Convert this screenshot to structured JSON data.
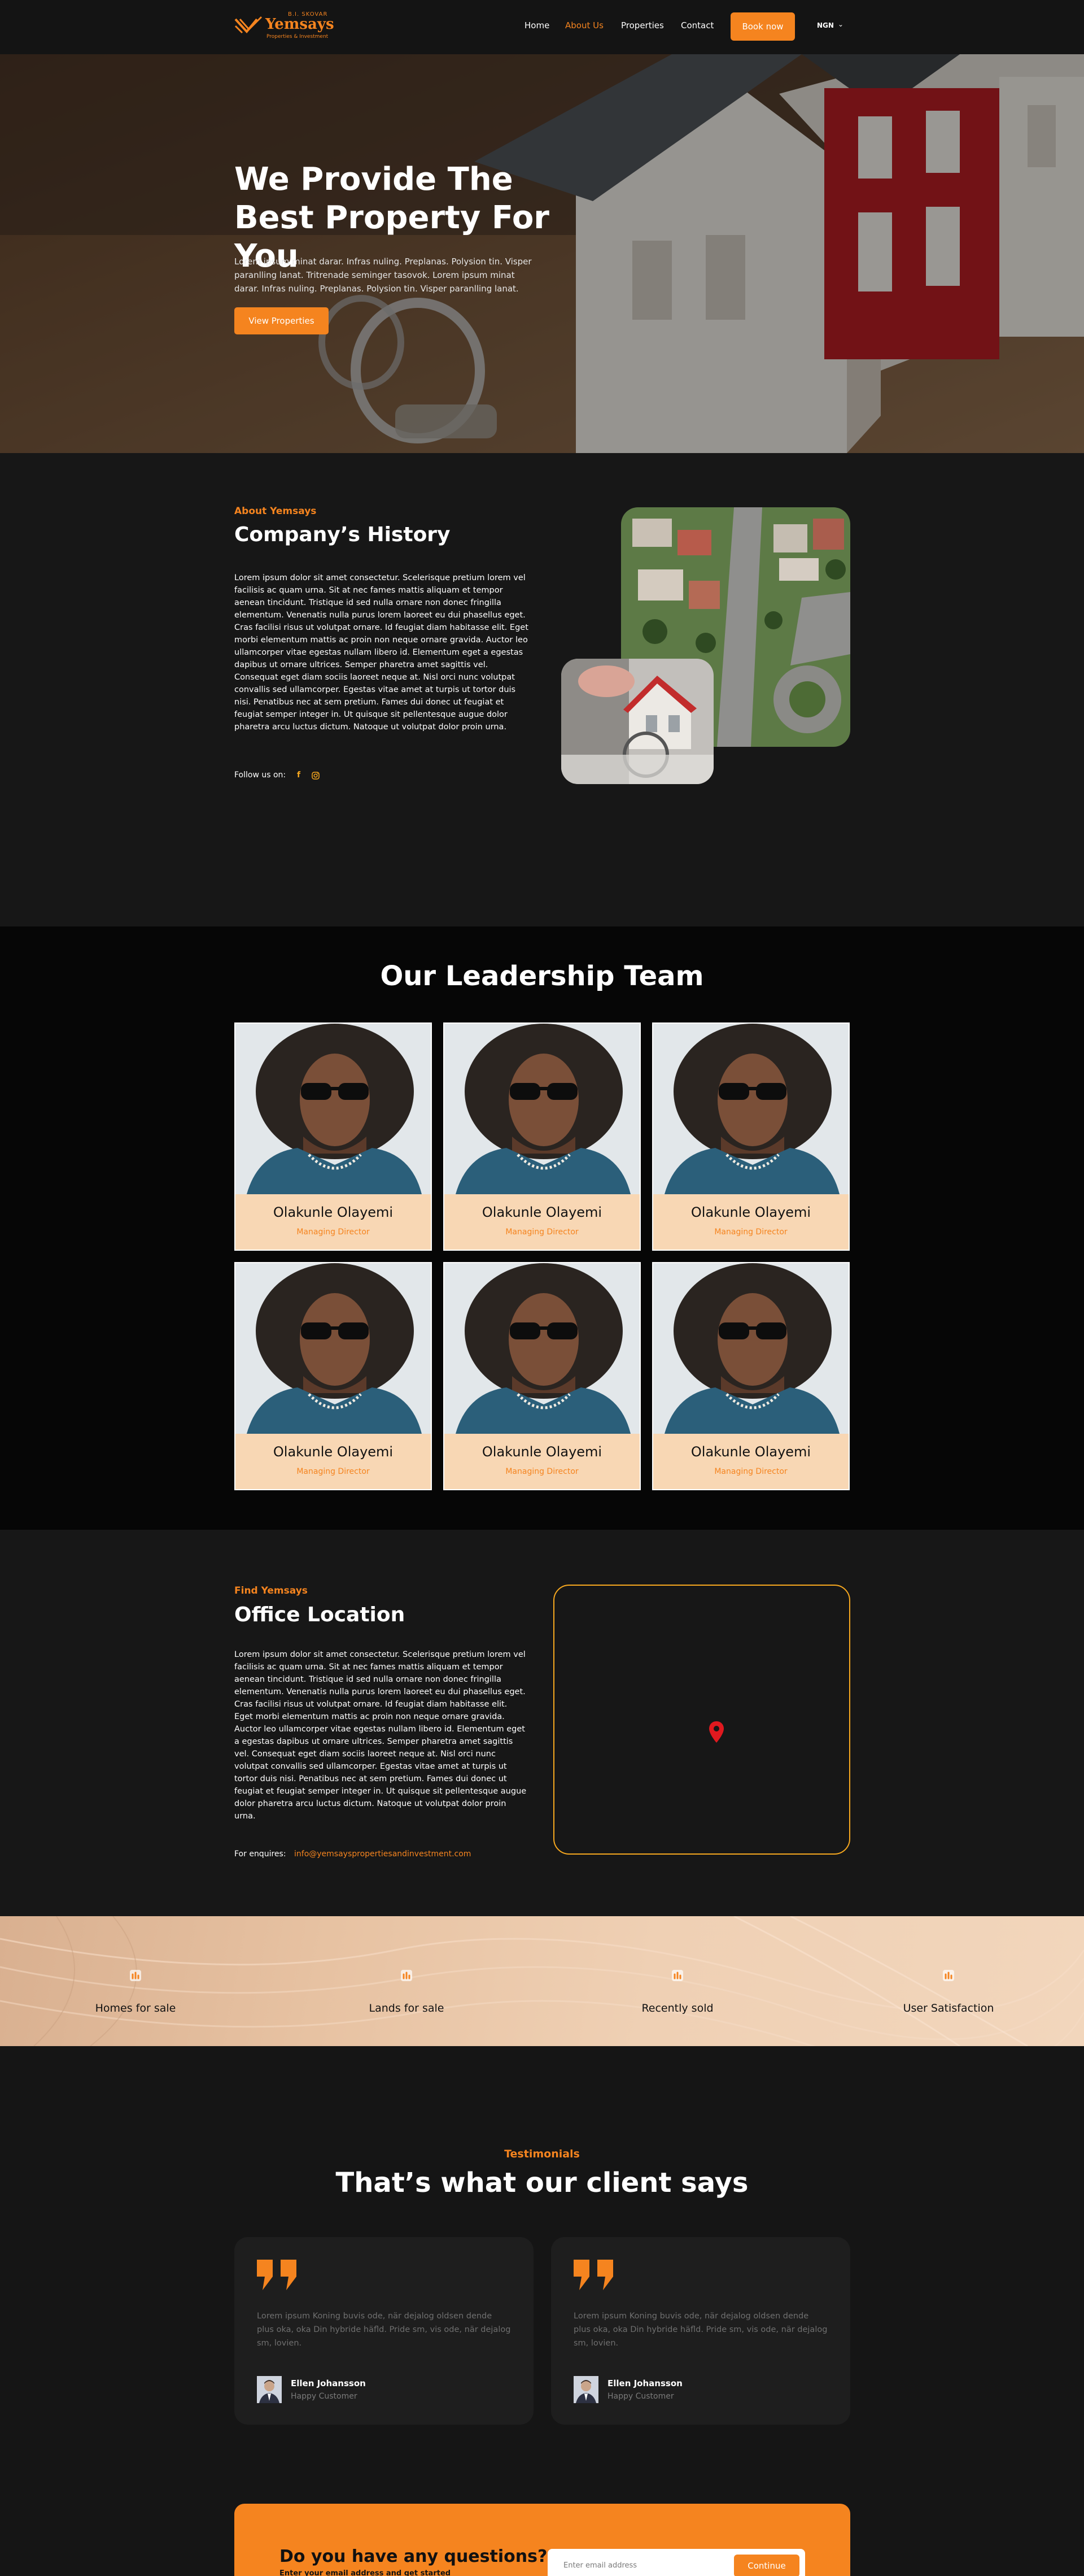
{
  "brand": {
    "small": "B.I. SKOVAR",
    "name": "Yemsays",
    "tagline": "Properties & Investment",
    "accent": "#f5841f"
  },
  "nav": {
    "items": [
      {
        "label": "Home",
        "active": false
      },
      {
        "label": "About Us",
        "active": true
      },
      {
        "label": "Properties",
        "active": false
      },
      {
        "label": "Contact",
        "active": false
      }
    ],
    "book_label": "Book now",
    "language": "NGN",
    "language_icon": "chevron-down-icon"
  },
  "hero": {
    "title": "We Provide The Best Property For You",
    "text": "Lorem ipsum minat darar. Infras nuling. Preplanas. Polysion tin. Visper paranlling lanat. Tritrenade seminger tasovok. Lorem ipsum minat darar. Infras nuling. Preplanas. Polysion tin. Visper paranlling lanat.",
    "button": "View Properties"
  },
  "about": {
    "eyebrow": "About Yemsays",
    "title": "Company’s History",
    "text": "Lorem ipsum dolor sit amet consectetur. Scelerisque pretium lorem vel facilisis ac quam urna. Sit at nec fames mattis aliquam et tempor aenean tincidunt. Tristique id sed nulla ornare non donec fringilla elementum. Venenatis nulla purus lorem laoreet eu dui phasellus eget. Cras facilisi risus ut volutpat ornare. Id feugiat diam habitasse elit. Eget morbi elementum mattis ac proin non neque ornare gravida. Auctor leo ullamcorper vitae egestas nullam libero id. Elementum eget a egestas dapibus ut ornare ultrices. Semper pharetra amet sagittis vel. Consequat eget diam sociis laoreet neque at. Nisl orci nunc volutpat convallis sed ullamcorper. Egestas vitae amet at turpis ut tortor duis nisi. Penatibus nec at sem pretium. Fames dui donec ut feugiat et feugiat semper integer in. Ut quisque sit pellentesque augue dolor pharetra arcu luctus dictum. Natoque ut volutpat dolor proin urna.",
    "follow_label": "Follow us on:",
    "social_icons": [
      "facebook-icon",
      "instagram-icon"
    ]
  },
  "team": {
    "title": "Our Leadership Team",
    "members": [
      {
        "name": "Olakunle Olayemi",
        "role": "Managing Director"
      },
      {
        "name": "Olakunle Olayemi",
        "role": "Managing Director"
      },
      {
        "name": "Olakunle Olayemi",
        "role": "Managing Director"
      },
      {
        "name": "Olakunle Olayemi",
        "role": "Managing Director"
      },
      {
        "name": "Olakunle Olayemi",
        "role": "Managing Director"
      },
      {
        "name": "Olakunle Olayemi",
        "role": "Managing Director"
      }
    ]
  },
  "office": {
    "eyebrow": "Find Yemsays",
    "title": "Office Location",
    "text": "Lorem ipsum dolor sit amet consectetur. Scelerisque pretium lorem vel facilisis ac quam urna. Sit at nec fames mattis aliquam et tempor aenean tincidunt. Tristique id sed nulla ornare non donec fringilla elementum. Venenatis nulla purus lorem laoreet eu dui phasellus eget. Cras facilisi risus ut volutpat ornare. Id feugiat diam habitasse elit. Eget morbi elementum mattis ac proin non neque ornare gravida. Auctor leo ullamcorper vitae egestas nullam libero id. Elementum eget a egestas dapibus ut ornare ultrices. Semper pharetra amet sagittis vel. Consequat eget diam sociis laoreet neque at. Nisl orci nunc volutpat convallis sed ullamcorper. Egestas vitae amet at turpis ut tortor duis nisi. Penatibus nec at sem pretium. Fames dui donec ut feugiat et feugiat semper integer in. Ut quisque sit pellentesque augue dolor pharetra arcu luctus dictum. Natoque ut volutpat dolor proin urna.",
    "enquiries_label": "For enquires:",
    "email": "info@yemsayspropertiesandinvestment.com",
    "map_pin_icon": "map-pin-icon"
  },
  "stats": {
    "items": [
      {
        "label": "Homes for sale",
        "icon": "chart-icon"
      },
      {
        "label": "Lands for sale",
        "icon": "chart-icon"
      },
      {
        "label": "Recently sold",
        "icon": "chart-icon"
      },
      {
        "label": "User Satisfaction",
        "icon": "chart-icon"
      }
    ]
  },
  "testimonials": {
    "eyebrow": "Testimonials",
    "title": "That’s what our client says",
    "items": [
      {
        "text": "Lorem ipsum Koning buvis ode, när dejalog oldsen dende plus oka, oka Din hybride häfld. Pride sm, vis ode, när dejalog sm, lovien.",
        "name": "Ellen Johansson",
        "role": "Happy Customer"
      },
      {
        "text": "Lorem ipsum Koning buvis ode, när dejalog oldsen dende plus oka, oka Din hybride häfld. Pride sm, vis ode, när dejalog sm, lovien.",
        "name": "Ellen Johansson",
        "role": "Happy Customer"
      }
    ]
  },
  "cta": {
    "title": "Do you have any questions?",
    "subtitle": "Enter your email address and get started",
    "placeholder": "Enter email address",
    "button": "Continue"
  }
}
